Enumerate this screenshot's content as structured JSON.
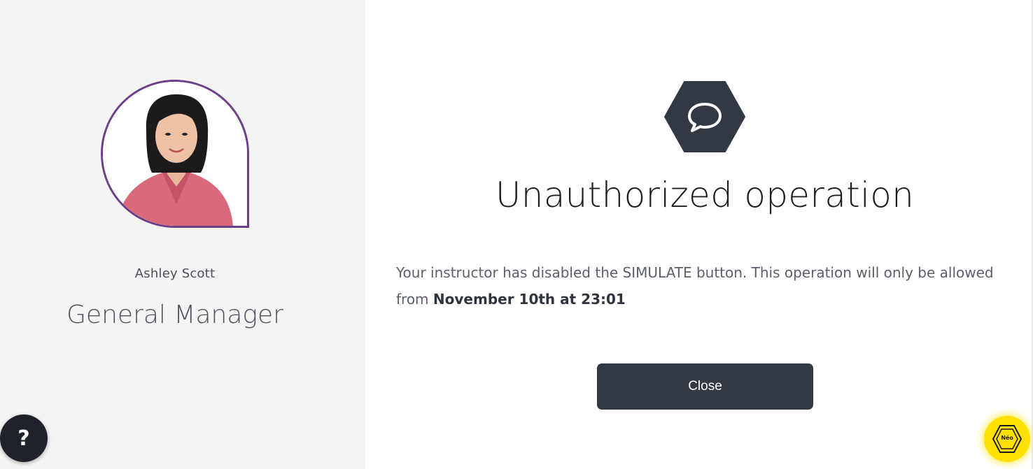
{
  "person": {
    "name": "Ashley Scott",
    "role": "General Manager"
  },
  "help": {
    "label": "?"
  },
  "modal": {
    "icon": "chat-bubble-icon",
    "title": "Unauthorized operation",
    "message_prefix": "Your instructor has disabled the SIMULATE button. This operation will only be allowed from ",
    "message_date": "November 10th at 23:01",
    "close_label": "Close"
  },
  "neo": {
    "label": "Néo"
  },
  "colors": {
    "left_panel_bg": "#f4f4f4",
    "avatar_border": "#6b3f8a",
    "hex_bg": "#333845",
    "close_button_bg": "#333845",
    "help_button_bg": "#1f222a",
    "neo_badge_bg": "#ffe100"
  }
}
